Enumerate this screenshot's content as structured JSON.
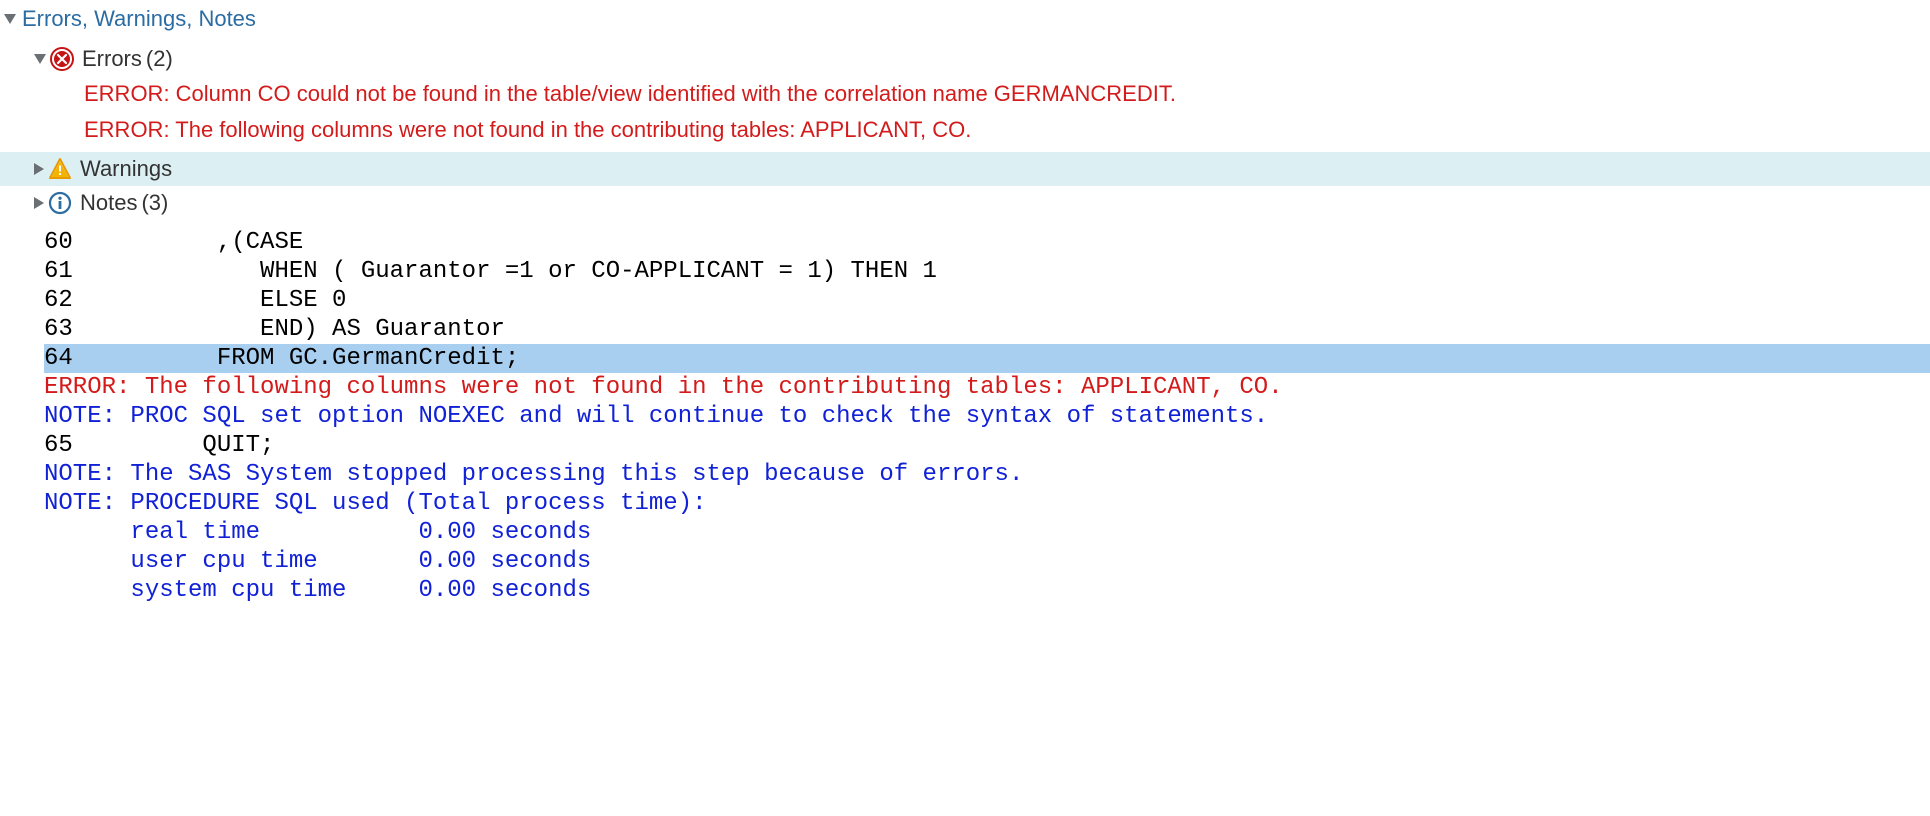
{
  "header": {
    "title": "Errors, Warnings, Notes"
  },
  "sections": {
    "errors": {
      "label": "Errors",
      "count": "(2)",
      "messages": [
        "ERROR: Column CO could not be found in the table/view identified with the correlation name GERMANCREDIT.",
        "ERROR: The following columns were not found in the contributing tables: APPLICANT, CO."
      ]
    },
    "warnings": {
      "label": "Warnings"
    },
    "notes": {
      "label": "Notes",
      "count": "(3)"
    }
  },
  "log": {
    "lines": [
      {
        "cls": "black",
        "text": "60          ,(CASE"
      },
      {
        "cls": "black",
        "text": "61             WHEN ( Guarantor =1 or CO-APPLICANT = 1) THEN 1"
      },
      {
        "cls": "black",
        "text": "62             ELSE 0"
      },
      {
        "cls": "black",
        "text": "63             END) AS Guarantor"
      },
      {
        "cls": "black hl",
        "text": "64          FROM GC.GermanCredit;"
      },
      {
        "cls": "red hl",
        "text": "ERROR: Column CO could not be found in the table/view identified with the correlation name GERMAN"
      },
      {
        "cls": "red",
        "text": "ERROR: The following columns were not found in the contributing tables: APPLICANT, CO."
      },
      {
        "cls": "blue",
        "text": "NOTE: PROC SQL set option NOEXEC and will continue to check the syntax of statements."
      },
      {
        "cls": "black",
        "text": "65         QUIT;"
      },
      {
        "cls": "blue",
        "text": "NOTE: The SAS System stopped processing this step because of errors."
      },
      {
        "cls": "blue",
        "text": "NOTE: PROCEDURE SQL used (Total process time):"
      },
      {
        "cls": "blue",
        "text": "      real time           0.00 seconds"
      },
      {
        "cls": "blue",
        "text": "      user cpu time       0.00 seconds"
      },
      {
        "cls": "blue",
        "text": "      system cpu time     0.00 seconds"
      }
    ]
  }
}
